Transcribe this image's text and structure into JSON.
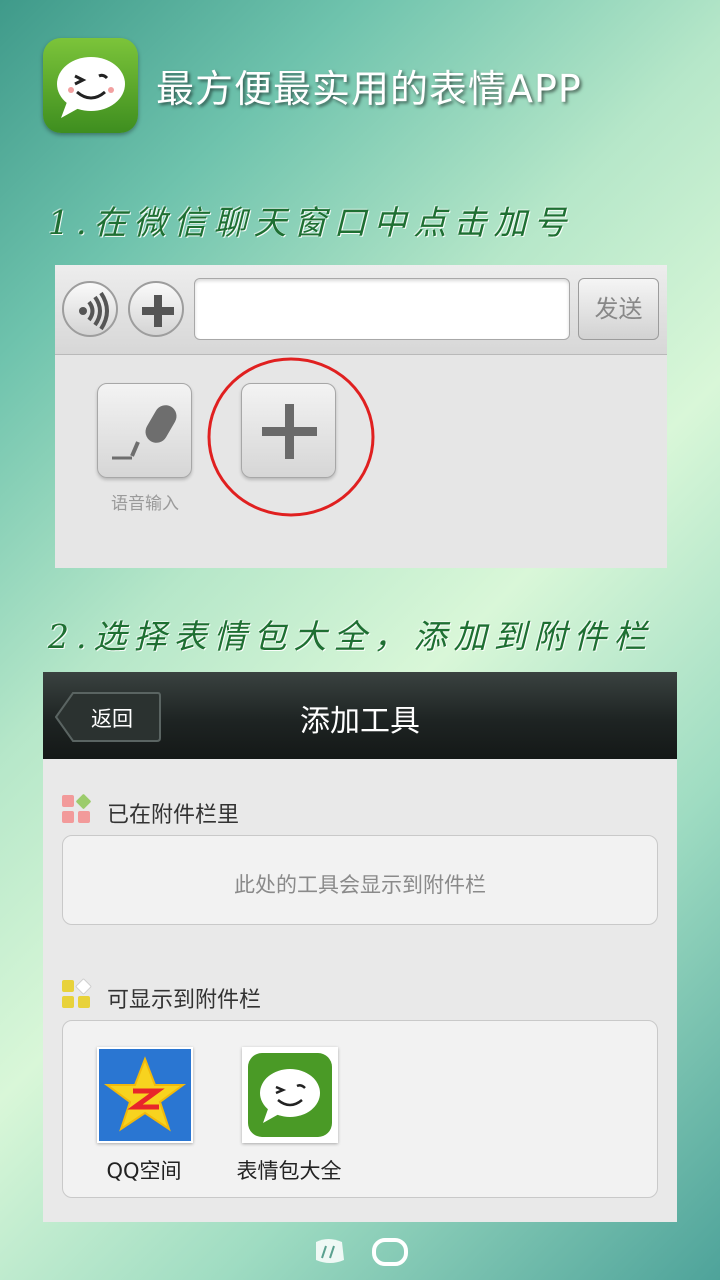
{
  "header": {
    "title": "最方便最实用的表情APP"
  },
  "steps": {
    "step1_caption": "1.在微信聊天窗口中点击加号",
    "step2_caption": "2.选择表情包大全，添加到附件栏"
  },
  "chat_panel": {
    "send_label": "发送",
    "input_value": "",
    "voice_input_label": "语音输入"
  },
  "add_tool_screen": {
    "back_label": "返回",
    "title": "添加工具",
    "section_in_attachment": {
      "heading": "已在附件栏里",
      "empty_hint": "此处的工具会显示到附件栏"
    },
    "section_available": {
      "heading": "可显示到附件栏",
      "items": [
        {
          "label": "QQ空间",
          "icon": "qzone-star-icon"
        },
        {
          "label": "表情包大全",
          "icon": "emoji-app-icon"
        }
      ]
    }
  },
  "colors": {
    "accent_green": "#4a9a26",
    "caption_green": "#1e6f32",
    "highlight_red": "#e02020"
  }
}
